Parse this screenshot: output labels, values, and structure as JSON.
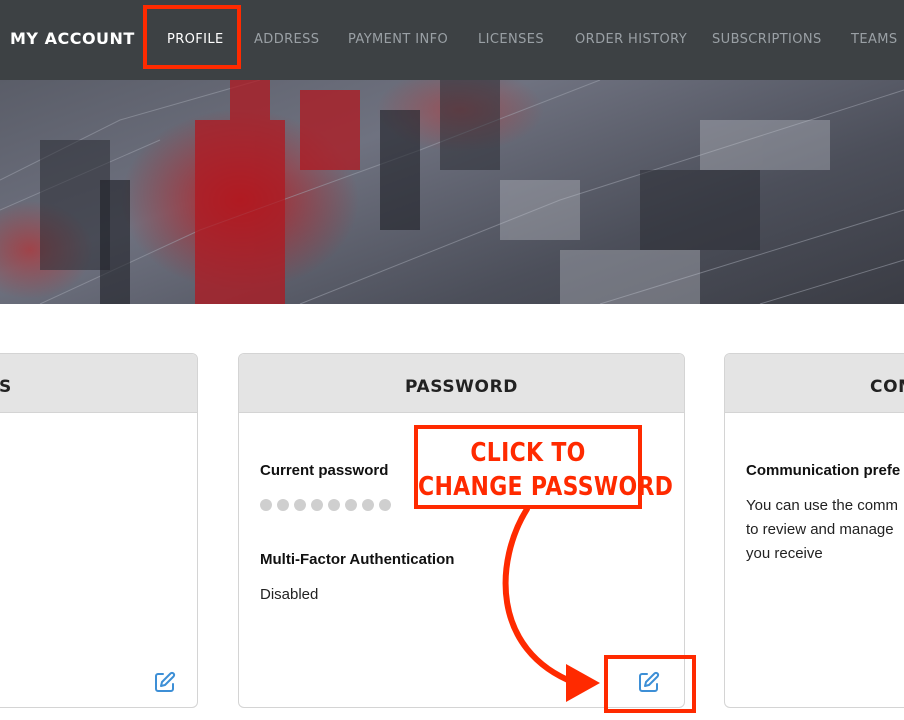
{
  "nav": {
    "brand": "MY ACCOUNT",
    "tabs": [
      {
        "label": "PROFILE",
        "active": true
      },
      {
        "label": "ADDRESS",
        "active": false
      },
      {
        "label": "PAYMENT INFO",
        "active": false
      },
      {
        "label": "LICENSES",
        "active": false
      },
      {
        "label": "ORDER HISTORY",
        "active": false
      },
      {
        "label": "SUBSCRIPTIONS",
        "active": false
      },
      {
        "label": "TEAMS",
        "active": false
      }
    ]
  },
  "cards": {
    "left": {
      "title_fragment": "S"
    },
    "password": {
      "title": "PASSWORD",
      "current_label": "Current password",
      "masked_dots": 8,
      "mfa_label": "Multi-Factor Authentication",
      "mfa_value": "Disabled"
    },
    "communication": {
      "title_fragment": "COM",
      "label": "Communication prefe",
      "lines": [
        "You can use the comm",
        "to review and manage",
        "you receive"
      ]
    }
  },
  "annotation": {
    "line1": "CLICK TO",
    "line2": "CHANGE PASSWORD"
  },
  "colors": {
    "nav_bg": "#3d4144",
    "highlight": "#ff2a00",
    "edit_icon": "#3d8fd6",
    "card_header": "#e4e4e4"
  },
  "icons": {
    "edit": "edit-pencil-square-icon",
    "arrow": "curved-arrow"
  }
}
